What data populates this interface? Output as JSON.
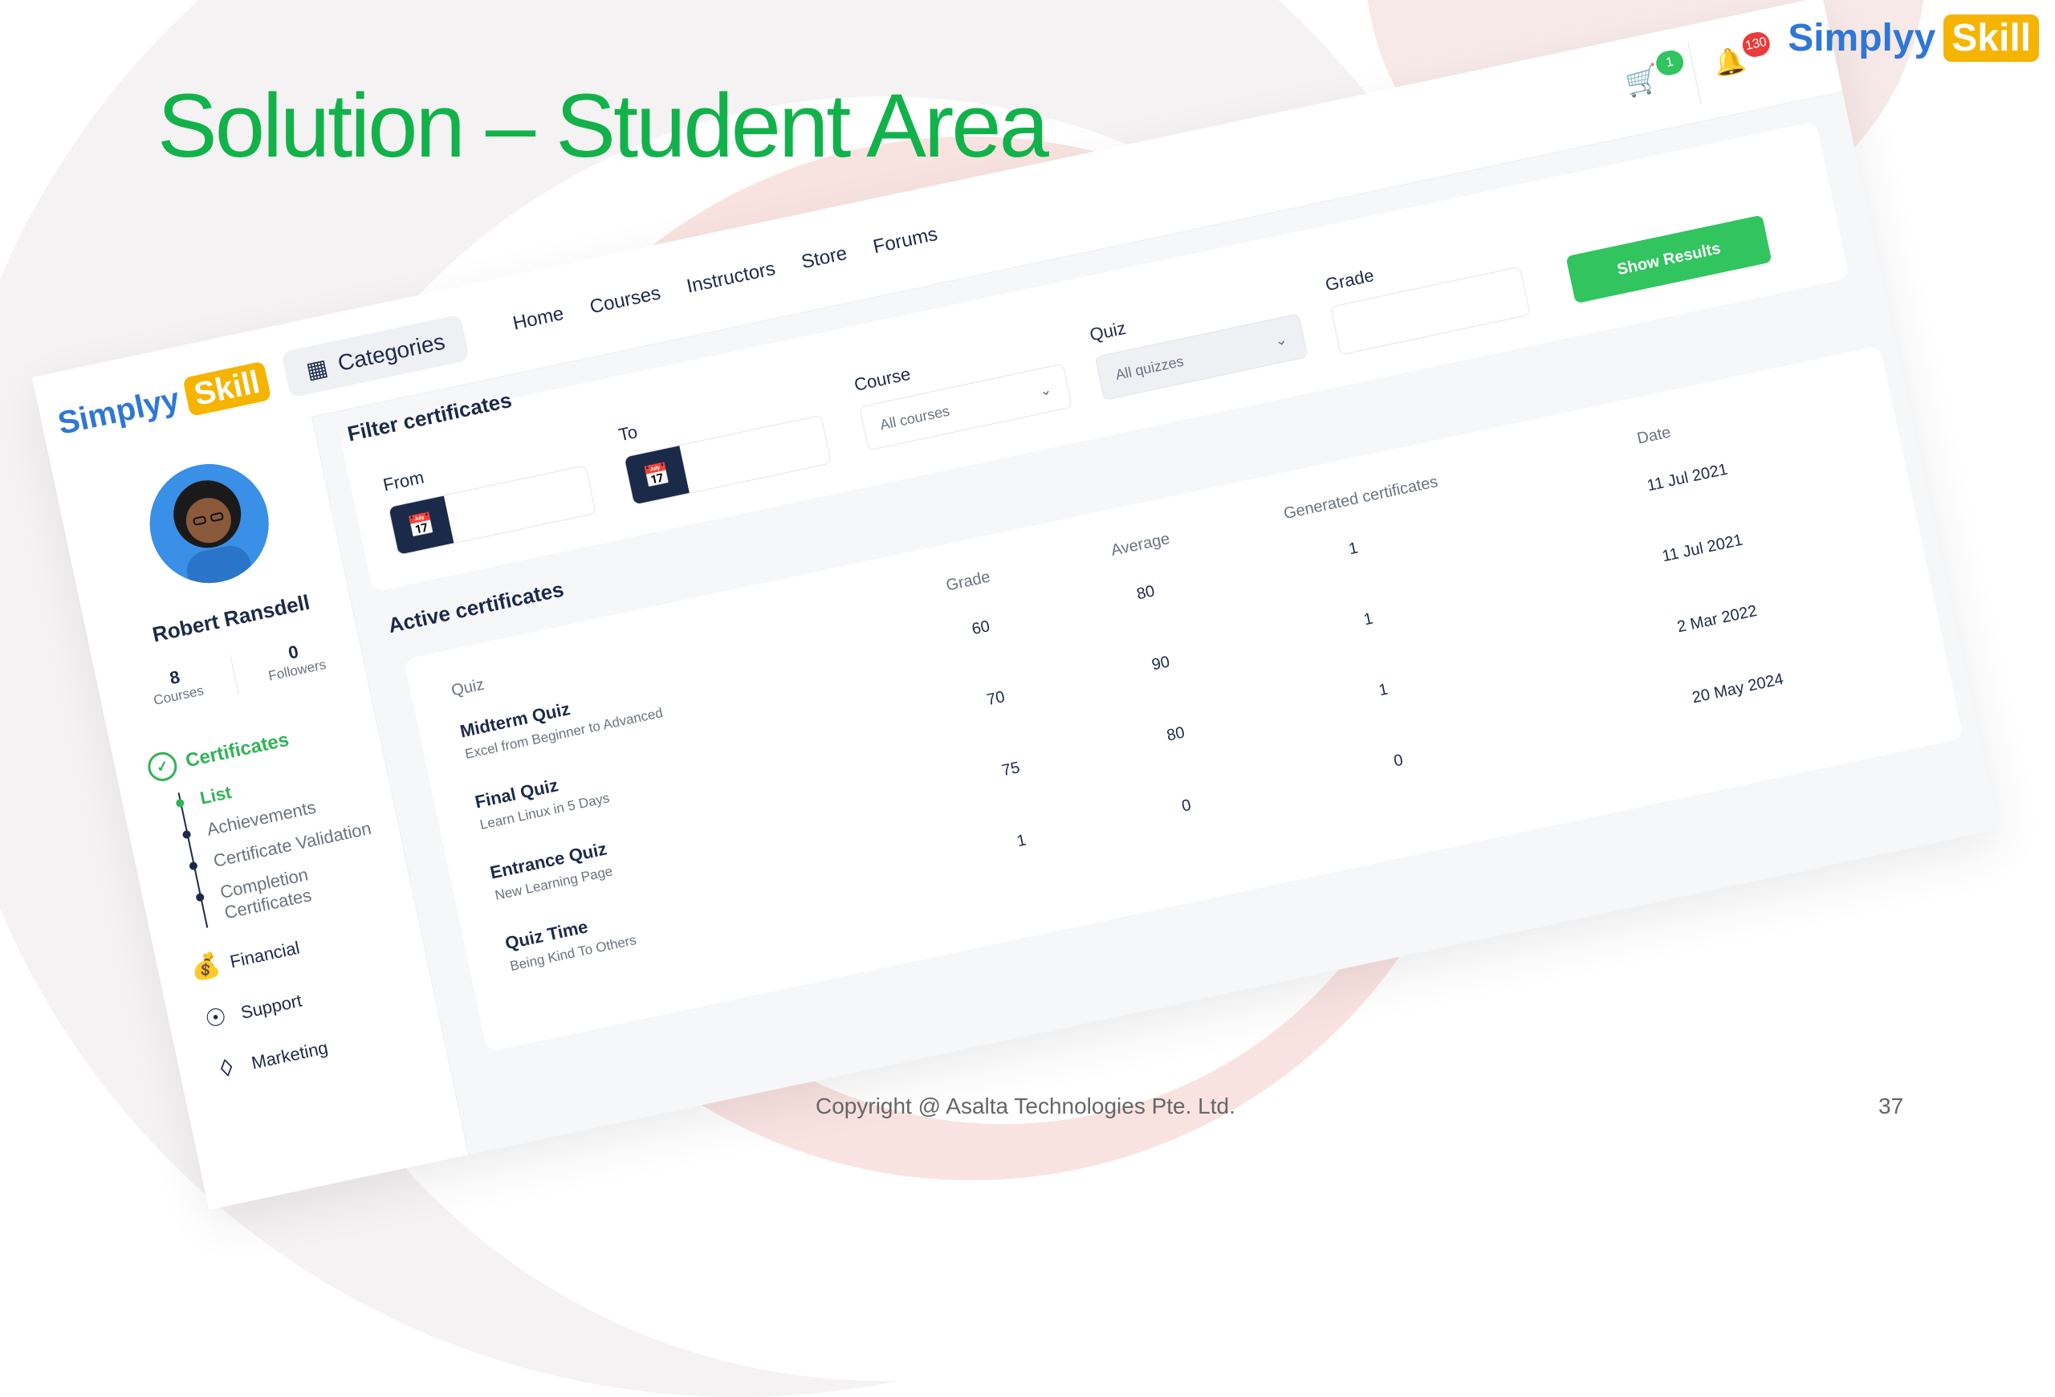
{
  "slide": {
    "title": "Solution – Student Area",
    "footer": "Copyright @ Asalta Technologies Pte. Ltd.",
    "page_number": "37",
    "brand_part1": "Simplyy",
    "brand_part2": "Skill",
    "title_color": "#12b24b"
  },
  "app": {
    "logo_part1": "Simplyy",
    "logo_part2": "Skill",
    "categories_label": "Categories",
    "nav": [
      "Home",
      "Courses",
      "Instructors",
      "Store",
      "Forums"
    ],
    "cart_count": "1",
    "notification_count": "130",
    "accent": "#31c45f",
    "navy": "#1c2a4a"
  },
  "sidebar": {
    "user_name": "Robert Ransdell",
    "courses_count": "8",
    "courses_label": "Courses",
    "followers_count": "0",
    "followers_label": "Followers",
    "certificates_label": "Certificates",
    "sub_items": [
      "List",
      "Achievements",
      "Certificate Validation",
      "Completion Certificates"
    ],
    "menu_items": [
      {
        "label": "Financial",
        "icon": "money-bag-icon"
      },
      {
        "label": "Support",
        "icon": "lifebuoy-icon"
      },
      {
        "label": "Marketing",
        "icon": "discount-tag-icon"
      }
    ]
  },
  "filter": {
    "title": "Filter certificates",
    "from_label": "From",
    "to_label": "To",
    "course_label": "Course",
    "course_value": "All courses",
    "quiz_label": "Quiz",
    "quiz_value": "All quizzes",
    "grade_label": "Grade",
    "show_button": "Show Results"
  },
  "certificates": {
    "title": "Active certificates",
    "headers": {
      "quiz": "Quiz",
      "grade": "Grade",
      "average": "Average",
      "generated": "Generated certificates",
      "date": "Date"
    },
    "rows": [
      {
        "quiz": "Midterm Quiz",
        "course": "Excel from Beginner to Advanced",
        "grade": "60",
        "average": "80",
        "generated": "1",
        "date": "11 Jul 2021"
      },
      {
        "quiz": "Final Quiz",
        "course": "Learn Linux in 5 Days",
        "grade": "70",
        "average": "90",
        "generated": "1",
        "date": "11 Jul 2021"
      },
      {
        "quiz": "Entrance Quiz",
        "course": "New Learning Page",
        "grade": "75",
        "average": "80",
        "generated": "1",
        "date": "2 Mar 2022"
      },
      {
        "quiz": "Quiz Time",
        "course": "Being Kind To Others",
        "grade": "1",
        "average": "0",
        "generated": "0",
        "date": "20 May 2024"
      }
    ]
  }
}
